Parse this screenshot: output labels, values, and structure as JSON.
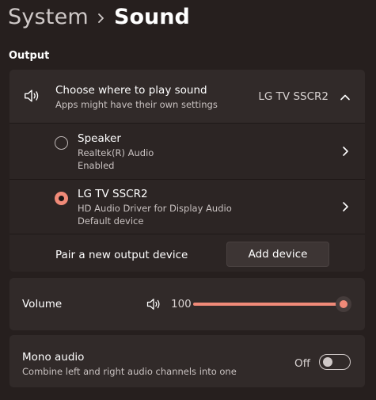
{
  "breadcrumb": {
    "parent": "System",
    "current": "Sound"
  },
  "output": {
    "section_title": "Output",
    "choose_title": "Choose where to play sound",
    "choose_subtitle": "Apps might have their own settings",
    "selected_device": "LG TV SSCR2",
    "devices": [
      {
        "name": "Speaker",
        "driver": "Realtek(R) Audio",
        "status": "Enabled",
        "selected": false
      },
      {
        "name": "LG TV SSCR2",
        "driver": "HD Audio Driver for Display Audio",
        "status": "Default device",
        "selected": true
      }
    ],
    "pair_label": "Pair a new output device",
    "add_device_label": "Add device"
  },
  "volume": {
    "label": "Volume",
    "value": "100",
    "level_percent": 100
  },
  "mono": {
    "title": "Mono audio",
    "subtitle": "Combine left and right audio channels into one",
    "state_label": "Off",
    "enabled": false
  },
  "colors": {
    "accent": "#f08a78",
    "background": "#261f1e",
    "card": "#312a29"
  },
  "icons": [
    "chevron-right-icon",
    "speaker-icon",
    "chevron-up-icon"
  ]
}
